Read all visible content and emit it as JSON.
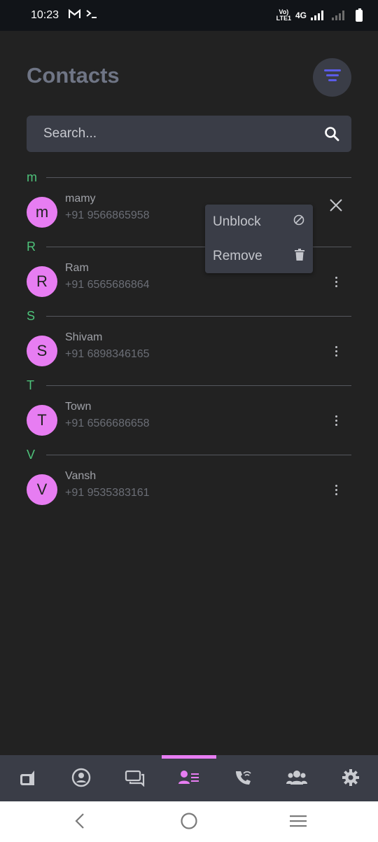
{
  "status_bar": {
    "time": "10:23",
    "network_label_top": "Vo)",
    "network_label_bottom": "LTE1",
    "network_type": "4G"
  },
  "header": {
    "title": "Contacts"
  },
  "search": {
    "placeholder": "Search..."
  },
  "sections": [
    {
      "letter": "m",
      "contacts": [
        {
          "initial": "m",
          "name": "mamy",
          "phone": "+91 9566865958"
        }
      ]
    },
    {
      "letter": "R",
      "contacts": [
        {
          "initial": "R",
          "name": "Ram",
          "phone": "+91 6565686864"
        }
      ]
    },
    {
      "letter": "S",
      "contacts": [
        {
          "initial": "S",
          "name": "Shivam",
          "phone": "+91 6898346165"
        }
      ]
    },
    {
      "letter": "T",
      "contacts": [
        {
          "initial": "T",
          "name": "Town",
          "phone": "+91 6566686658"
        }
      ]
    },
    {
      "letter": "V",
      "contacts": [
        {
          "initial": "V",
          "name": "Vansh",
          "phone": "+91 9535383161"
        }
      ]
    }
  ],
  "context_menu": {
    "items": [
      {
        "label": "Unblock",
        "icon": "block-icon"
      },
      {
        "label": "Remove",
        "icon": "trash-icon"
      }
    ]
  },
  "bottom_nav": {
    "items": [
      {
        "icon": "video-call-icon"
      },
      {
        "icon": "profile-icon"
      },
      {
        "icon": "chat-icon"
      },
      {
        "icon": "contacts-icon",
        "active": true
      },
      {
        "icon": "wifi-call-icon"
      },
      {
        "icon": "groups-icon"
      },
      {
        "icon": "settings-icon"
      }
    ]
  },
  "colors": {
    "background": "#222222",
    "accent": "#e77df2",
    "section_letter": "#4ec27a",
    "surface": "#3a3d47",
    "filter_icon": "#5b5ce8"
  }
}
